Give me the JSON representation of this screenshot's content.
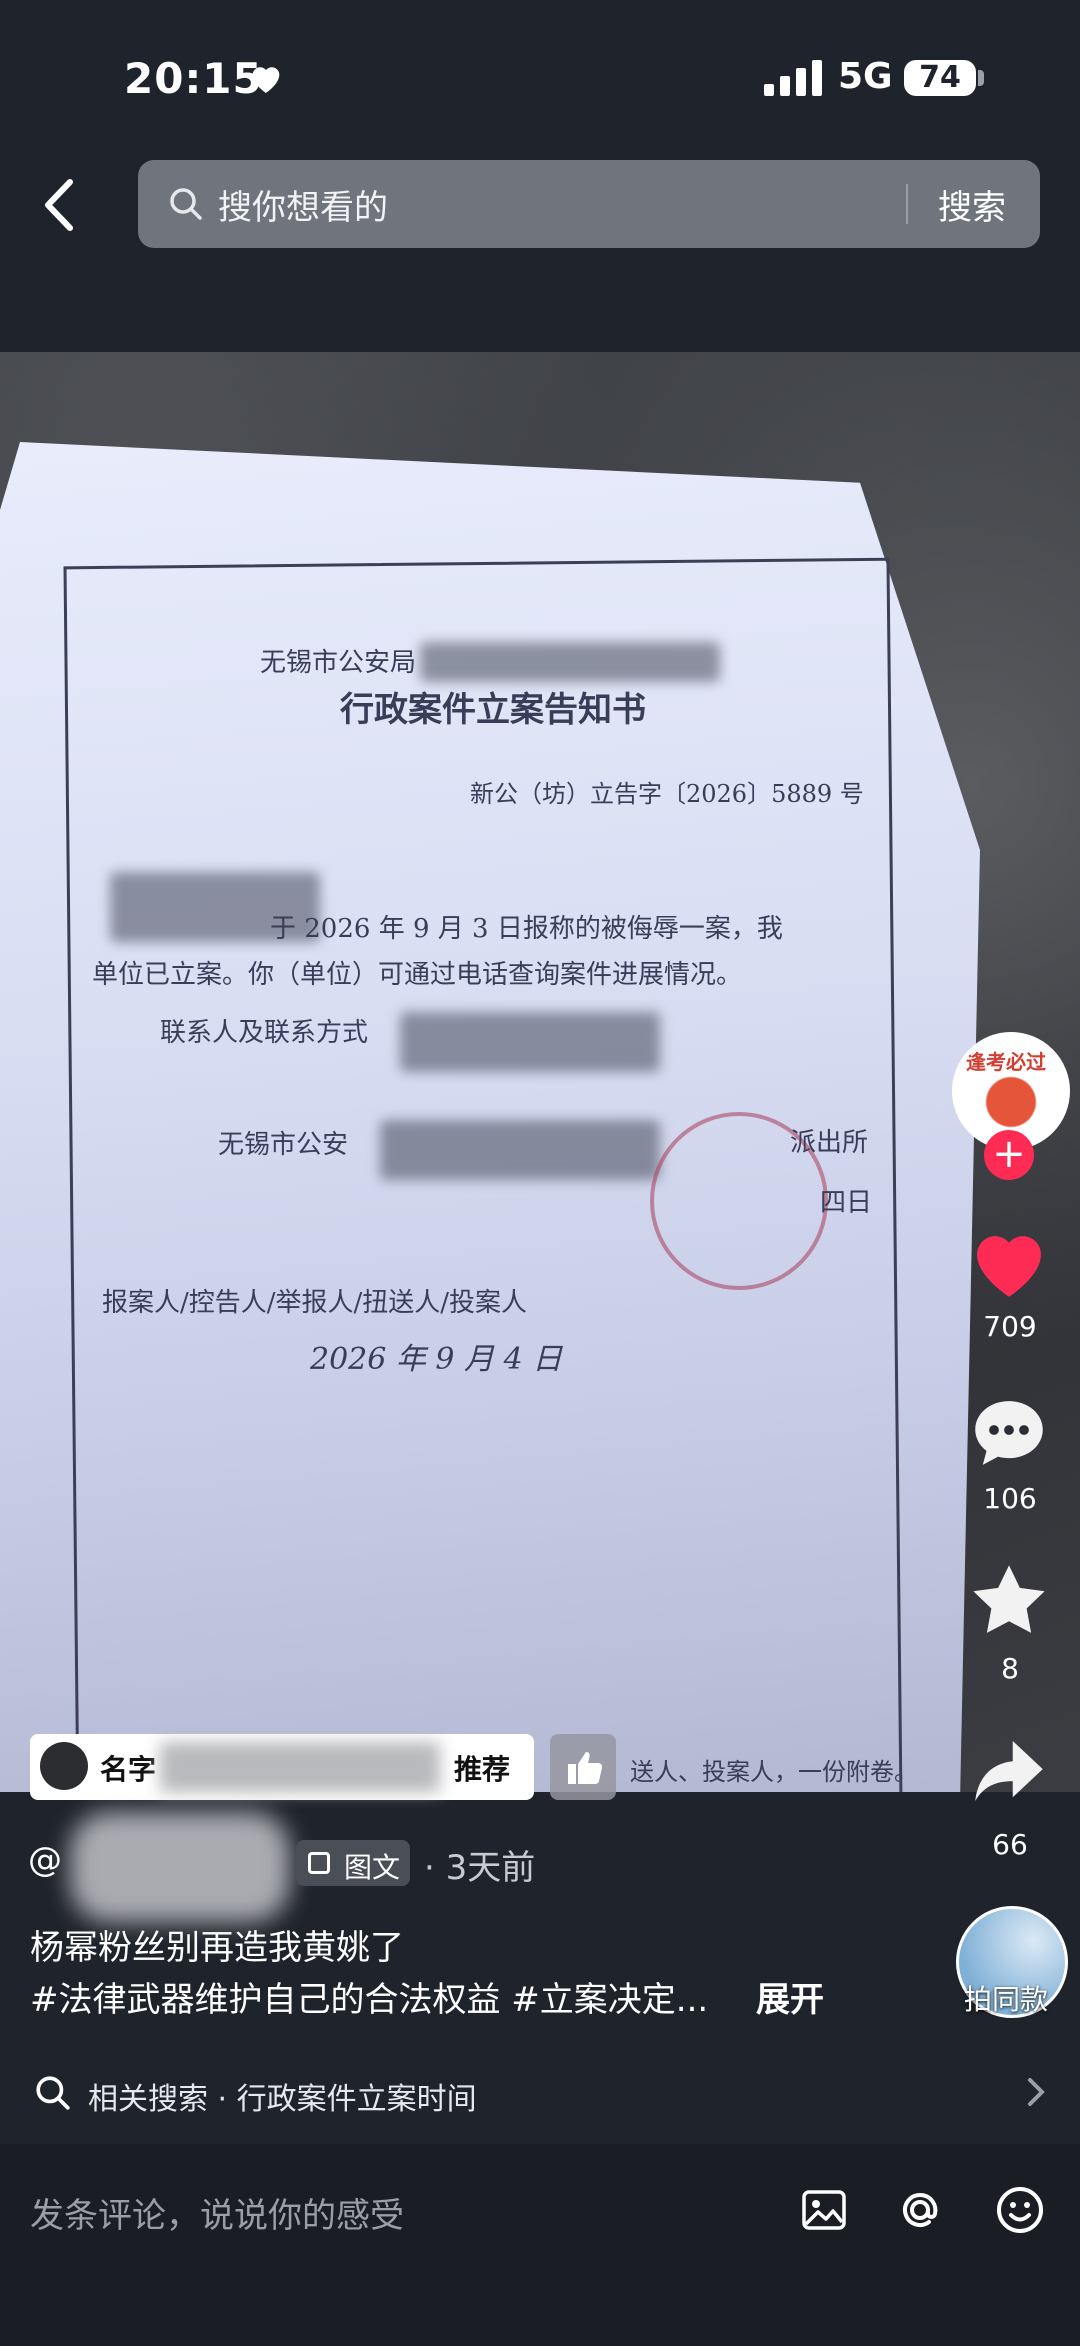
{
  "status_bar": {
    "time": "20:15",
    "network": "5G",
    "battery": "74"
  },
  "search": {
    "placeholder": "搜你想看的",
    "submit_label": "搜索"
  },
  "document": {
    "agency": "无锡市公安局",
    "title": "行政案件立案告知书",
    "number": "新公（坊）立告字〔2026〕5889 号",
    "line1": "于 2026 年 9 月 3 日报称的被侮辱一案，我",
    "line2": "单位已立案。你（单位）可通过电话查询案件进展情况。",
    "contact": "联系人及联系方式",
    "agency2": "无锡市公安",
    "sign_right1": "派出所",
    "sign_right2": "四日",
    "reporter": "报案人/控告人/举报人/扭送人/投案人",
    "handwritten_date": "2026 年 9 月 4 日",
    "footer": "送人、投案人，一份附卷。"
  },
  "actions": {
    "avatar_text": "逢考必过",
    "follow": "+",
    "likes": "709",
    "comments": "106",
    "favorites": "8",
    "shares": "66",
    "remix": "拍同款"
  },
  "recommend_chip": {
    "name": "名字",
    "label": "推荐"
  },
  "post": {
    "author_prefix": "@",
    "type_label": "图文",
    "time_ago": "· 3天前",
    "caption": "杨幂粉丝别再造我黄姚了",
    "tags": "#法律武器维护自己的合法权益 #立案决定...",
    "expand": "展开"
  },
  "related_search": {
    "text": "相关搜索 · 行政案件立案时间"
  },
  "comment_bar": {
    "placeholder": "发条评论，说说你的感受"
  },
  "colors": {
    "like_red": "#fe2c55",
    "background": "#1f232b",
    "search_bg": "#6f747d"
  }
}
